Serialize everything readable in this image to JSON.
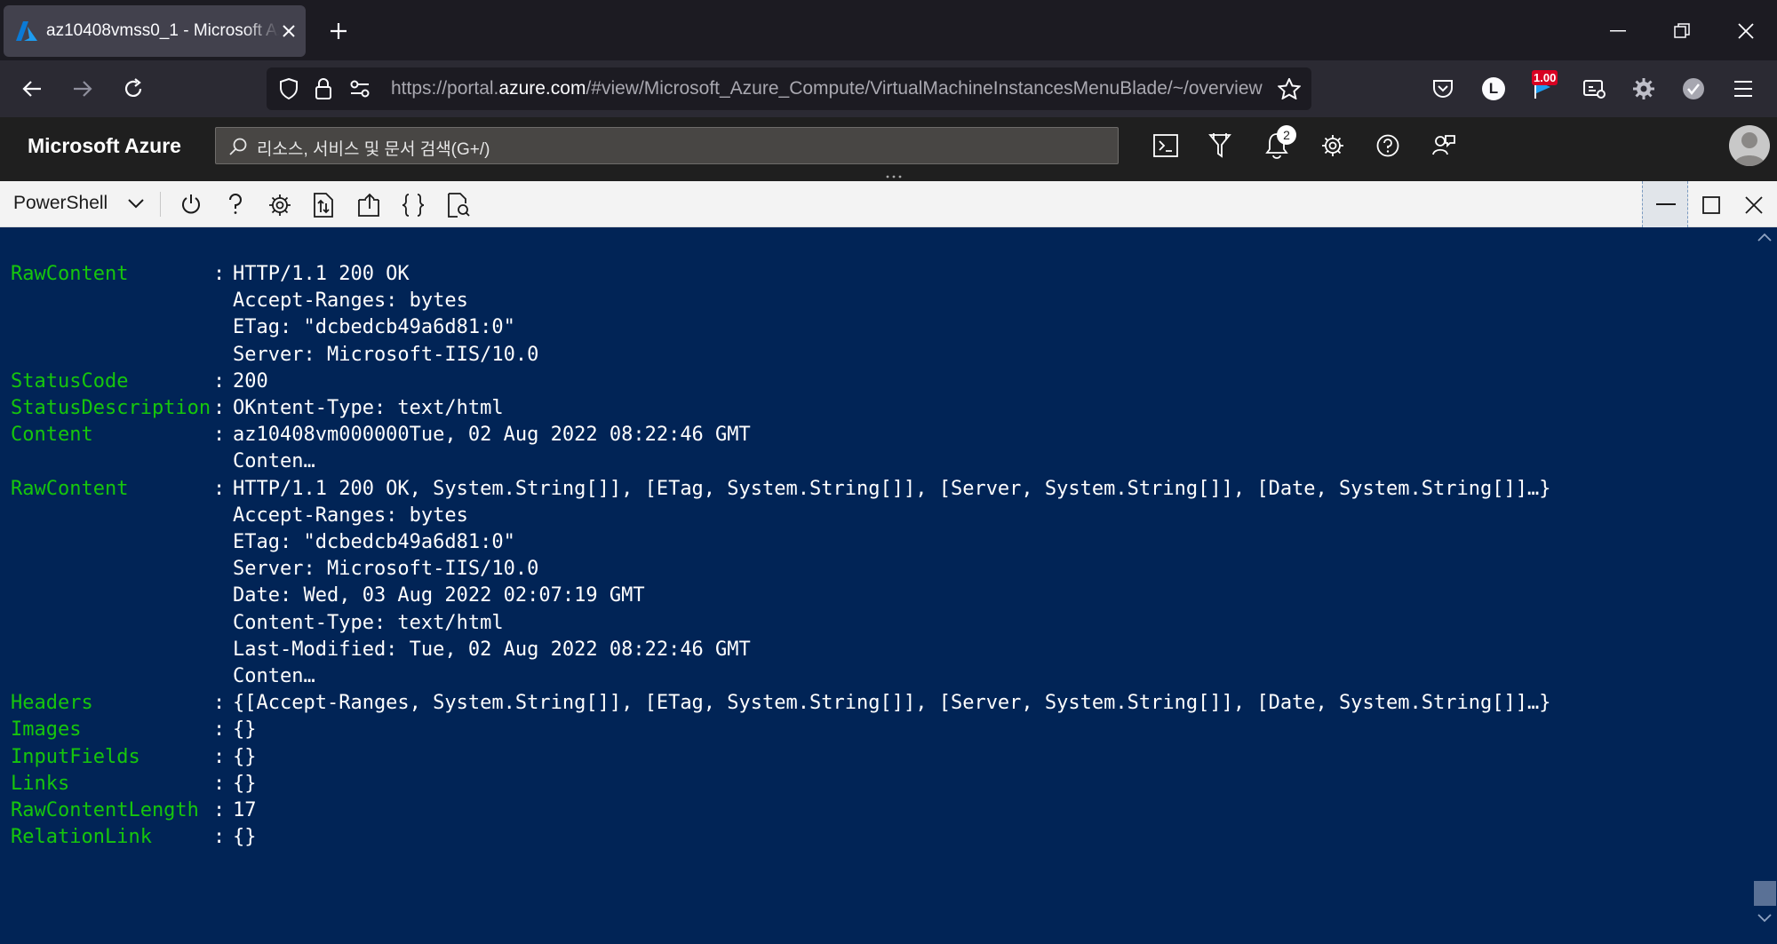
{
  "browser": {
    "tab_title": "az10408vmss0_1 - Microsoft Azure",
    "url_prefix": "https://portal.",
    "url_domain": "azure.com",
    "url_rest": "/#view/Microsoft_Azure_Compute/VirtualMachineInstancesMenuBlade/~/overview",
    "extension_badge": "1.00",
    "profile_letter": "L"
  },
  "azure": {
    "brand": "Microsoft Azure",
    "search_placeholder": "리소스, 서비스 및 문서 검색(G+/)",
    "notification_count": "2"
  },
  "cloudshell": {
    "shell": "PowerShell"
  },
  "terminal": {
    "lines": [
      {
        "key": "RawContent",
        "value": "HTTP/1.1 200 OK"
      },
      {
        "key": "",
        "value": "Accept-Ranges: bytes"
      },
      {
        "key": "",
        "value": "ETag: \"dcbedcb49a6d81:0\""
      },
      {
        "key": "",
        "value": "Server: Microsoft-IIS/10.0"
      },
      {
        "key": "StatusCode",
        "value": "200"
      },
      {
        "key": "StatusDescription",
        "value": "OKntent-Type: text/html"
      },
      {
        "key": "Content",
        "value": "az10408vm000000Tue, 02 Aug 2022 08:22:46 GMT"
      },
      {
        "key": "",
        "value": "Conten…"
      },
      {
        "key": "RawContent",
        "value": "HTTP/1.1 200 OK, System.String[]], [ETag, System.String[]], [Server, System.String[]], [Date, System.String[]]…}"
      },
      {
        "key": "",
        "value": "Accept-Ranges: bytes"
      },
      {
        "key": "",
        "value": "ETag: \"dcbedcb49a6d81:0\""
      },
      {
        "key": "",
        "value": "Server: Microsoft-IIS/10.0"
      },
      {
        "key": "",
        "value": "Date: Wed, 03 Aug 2022 02:07:19 GMT"
      },
      {
        "key": "",
        "value": "Content-Type: text/html"
      },
      {
        "key": "",
        "value": "Last-Modified: Tue, 02 Aug 2022 08:22:46 GMT"
      },
      {
        "key": "",
        "value": "Conten…"
      },
      {
        "key": "Headers",
        "value": "{[Accept-Ranges, System.String[]], [ETag, System.String[]], [Server, System.String[]], [Date, System.String[]]…}"
      },
      {
        "key": "Images",
        "value": "{}"
      },
      {
        "key": "InputFields",
        "value": "{}"
      },
      {
        "key": "Links",
        "value": "{}"
      },
      {
        "key": "RawContentLength",
        "value": "17"
      },
      {
        "key": "RelationLink",
        "value": "{}"
      }
    ]
  },
  "colors": {
    "terminal_bg": "#012456",
    "key_green": "#16c60c",
    "azure_header": "#1f1f1f"
  }
}
